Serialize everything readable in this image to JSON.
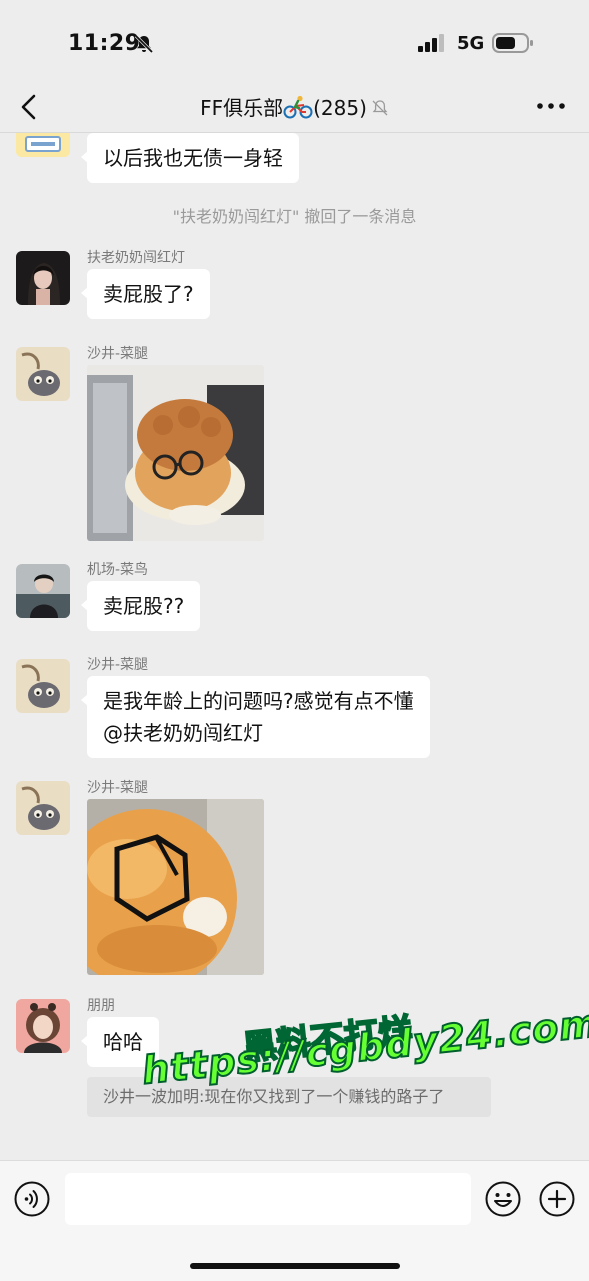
{
  "status": {
    "time": "11:29",
    "network": "5G"
  },
  "header": {
    "title": "FF俱乐部",
    "member_count": "(285)",
    "back_icon": "chevron-left-icon",
    "more_icon": "more-dots-icon"
  },
  "messages": {
    "m0": {
      "text": "以后我也无债一身轻"
    },
    "system": {
      "text": "\"扶老奶奶闯红灯\" 撤回了一条消息"
    },
    "m1": {
      "sender": "扶老奶奶闯红灯",
      "text": "卖屁股了?"
    },
    "m2": {
      "sender": "沙井-菜腿"
    },
    "m3": {
      "sender": "机场-菜鸟",
      "text": "卖屁股??"
    },
    "m4": {
      "sender": "沙井-菜腿",
      "line1": "是我年龄上的问题吗?感觉有点不懂",
      "line2": "@扶老奶奶闯红灯"
    },
    "m5": {
      "sender": "沙井-菜腿"
    },
    "m6": {
      "sender": "朋朋",
      "text": "哈哈",
      "quote": "沙井一波加明:现在你又找到了一个赚钱的路子了"
    }
  },
  "watermark": {
    "line1": "黑料不打烊",
    "line2": "https://cgbdy24.com"
  },
  "input": {
    "placeholder": ""
  },
  "colors": {
    "background": "#ededed",
    "bubble": "#ffffff",
    "watermark": "#66ff33"
  }
}
